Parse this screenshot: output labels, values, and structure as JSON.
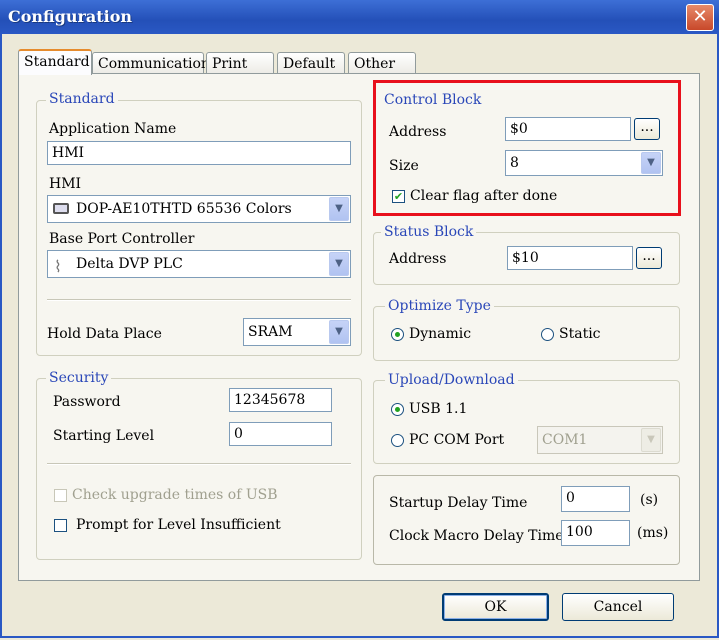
{
  "window": {
    "title": "Configuration",
    "close": "✕"
  },
  "tabs": [
    "Standard",
    "Communication",
    "Print",
    "Default",
    "Other"
  ],
  "standard": {
    "group": "Standard",
    "app_name_label": "Application Name",
    "app_name": "HMI",
    "hmi_label": "HMI",
    "hmi": "DOP-AE10THTD 65536 Colors",
    "base_port_label": "Base Port Controller",
    "base_port": "Delta DVP PLC",
    "hold_label": "Hold Data Place",
    "hold": "SRAM"
  },
  "security": {
    "group": "Security",
    "password_label": "Password",
    "password": "12345678",
    "level_label": "Starting Level",
    "level": "0",
    "check_usb": "Check upgrade times of USB",
    "check_usb_checked": false,
    "prompt": "Prompt for Level Insufficient",
    "prompt_checked": false
  },
  "control_block": {
    "group": "Control Block",
    "address_label": "Address",
    "address": "$0",
    "size_label": "Size",
    "size": "8",
    "clear_flag": "Clear flag after done",
    "clear_flag_checked": true,
    "browse": "..."
  },
  "status_block": {
    "group": "Status Block",
    "address_label": "Address",
    "address": "$10",
    "browse": "..."
  },
  "optimize": {
    "group": "Optimize Type",
    "dynamic": "Dynamic",
    "static": "Static",
    "selected": "Dynamic"
  },
  "upload": {
    "group": "Upload/Download",
    "usb": "USB 1.1",
    "pc_com": "PC COM Port",
    "com": "COM1",
    "selected": "USB 1.1"
  },
  "delay": {
    "startup_label": "Startup Delay Time",
    "startup": "0",
    "startup_unit": "(s)",
    "clock_label": "Clock Macro Delay Time",
    "clock": "100",
    "clock_unit": "(ms)"
  },
  "buttons": {
    "ok": "OK",
    "cancel": "Cancel"
  },
  "colors": {
    "highlight": "#e8101c",
    "accent": "#2a47b8"
  }
}
